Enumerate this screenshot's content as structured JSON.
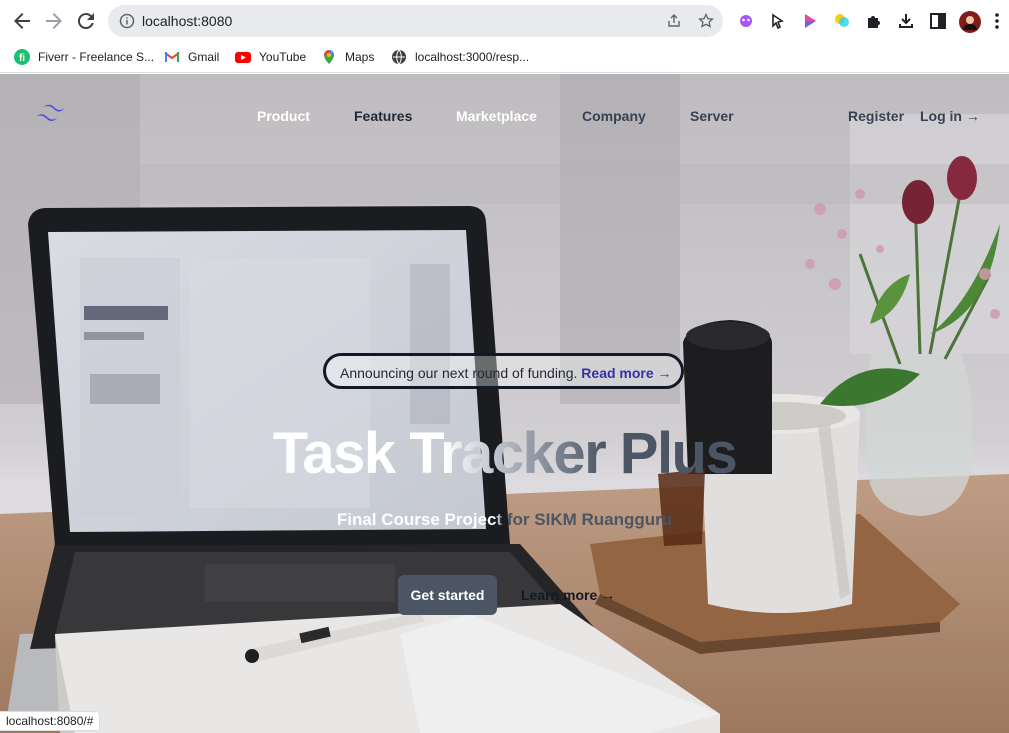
{
  "browser": {
    "url": "localhost:8080",
    "bookmarks": [
      {
        "label": "Fiverr - Freelance S...",
        "icon": "fiverr-icon"
      },
      {
        "label": "Gmail",
        "icon": "gmail-icon"
      },
      {
        "label": "YouTube",
        "icon": "youtube-icon"
      },
      {
        "label": "Maps",
        "icon": "maps-icon"
      },
      {
        "label": "localhost:3000/resp...",
        "icon": "globe-icon"
      }
    ],
    "status_url": "localhost:8080/#"
  },
  "nav": {
    "links": [
      "Product",
      "Features",
      "Marketplace",
      "Company",
      "Server"
    ],
    "register": "Register",
    "login": "Log in →"
  },
  "hero": {
    "announcement": "Announcing our next round of funding.",
    "announcement_link": "Read more →",
    "title": "Task Tracker Plus",
    "subtitle": "Final Course Project for SIKM Ruangguru",
    "primary_button": "Get started",
    "secondary_button": "Learn more →"
  },
  "colors": {
    "brand": "#4f46e5",
    "primary_button": "#4b5563",
    "link": "#3730a3"
  }
}
